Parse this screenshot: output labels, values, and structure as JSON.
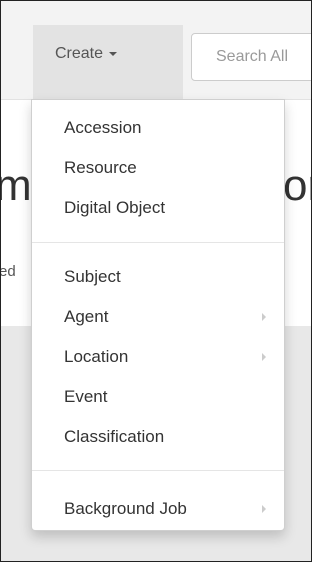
{
  "navbar": {
    "create_label": "Create",
    "search_placeholder": "Search All"
  },
  "background": {
    "heading_left": "m",
    "heading_right": "or",
    "subtext": "ed"
  },
  "create_menu": {
    "group1": [
      {
        "label": "Accession"
      },
      {
        "label": "Resource"
      },
      {
        "label": "Digital Object"
      }
    ],
    "group2": [
      {
        "label": "Subject"
      },
      {
        "label": "Agent",
        "has_submenu": true
      },
      {
        "label": "Location",
        "has_submenu": true
      },
      {
        "label": "Event"
      },
      {
        "label": "Classification"
      }
    ],
    "group3": [
      {
        "label": "Background Job",
        "has_submenu": true
      }
    ]
  },
  "colors": {
    "navbar_bg": "#f3f3f3",
    "active_toggle_bg": "#e3e3e3",
    "menu_text": "#333333",
    "placeholder_text": "#9a9a9a"
  }
}
